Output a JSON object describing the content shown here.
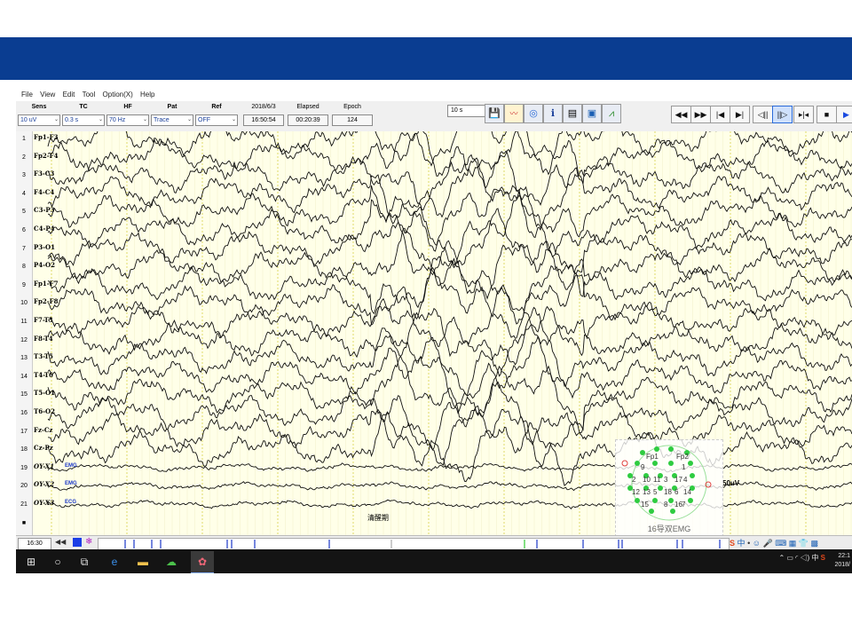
{
  "menu": [
    "File",
    "View",
    "Edit",
    "Tool",
    "Option(X)",
    "Help"
  ],
  "controls": {
    "sens": {
      "label": "Sens",
      "value": "10 uV"
    },
    "tc": {
      "label": "TC",
      "value": "0.3 s"
    },
    "hf": {
      "label": "HF",
      "value": "70 Hz"
    },
    "pat": {
      "label": "Pat",
      "value": "Trace"
    },
    "ref": {
      "label": "Ref",
      "value": "OFF"
    },
    "date": {
      "label": "2018/6/3",
      "value": "16:50:54"
    },
    "elapsed": {
      "label": "Elapsed",
      "value": "00:20:39"
    },
    "epoch": {
      "label": "Epoch",
      "value": "124"
    }
  },
  "window_select": "10 s",
  "toolbar_icons": [
    "save-icon",
    "signal-on-icon",
    "globe-icon",
    "patient-icon",
    "printer-icon",
    "camera-icon",
    "chart-icon"
  ],
  "nav_buttons": [
    {
      "glyph": "◀◀",
      "name": "rewind"
    },
    {
      "glyph": "▶▶",
      "name": "fast-forward"
    },
    {
      "glyph": "|◀",
      "name": "page-start"
    },
    {
      "glyph": "▶|",
      "name": "page-end"
    },
    {
      "glyph": "◁||",
      "name": "step-back"
    },
    {
      "glyph": "||▷",
      "name": "step-forward"
    },
    {
      "glyph": "▸|◂",
      "name": "compress"
    },
    {
      "glyph": "■",
      "name": "stop"
    },
    {
      "glyph": "▶",
      "name": "play"
    }
  ],
  "channels": [
    {
      "num": "1",
      "label": "Fp1-F3"
    },
    {
      "num": "2",
      "label": "Fp2-F4"
    },
    {
      "num": "3",
      "label": "F3-C3"
    },
    {
      "num": "4",
      "label": "F4-C4"
    },
    {
      "num": "5",
      "label": "C3-P3"
    },
    {
      "num": "6",
      "label": "C4-P4"
    },
    {
      "num": "7",
      "label": "P3-O1"
    },
    {
      "num": "8",
      "label": "P4-O2"
    },
    {
      "num": "9",
      "label": "Fp1-F7"
    },
    {
      "num": "10",
      "label": "Fp2-F8"
    },
    {
      "num": "11",
      "label": "F7-T3"
    },
    {
      "num": "12",
      "label": "F8-T4"
    },
    {
      "num": "13",
      "label": "T3-T5"
    },
    {
      "num": "14",
      "label": "T4-T6"
    },
    {
      "num": "15",
      "label": "T5-O1"
    },
    {
      "num": "16",
      "label": "T6-O2"
    },
    {
      "num": "17",
      "label": "Fz-Cz"
    },
    {
      "num": "18",
      "label": "Cz-Pz"
    },
    {
      "num": "19",
      "label": "OY-X1",
      "type": "EMG"
    },
    {
      "num": "20",
      "label": "OY-X2",
      "type": "EMG"
    },
    {
      "num": "21",
      "label": "OY-X3",
      "type": "ECG"
    },
    {
      "num": "■",
      "label": ""
    }
  ],
  "scale_label": "50uV",
  "annotation": "清醒期",
  "montage": {
    "title": "16导双EMG",
    "pins": [
      "Fp1",
      "Fp2",
      "9",
      "1",
      "2",
      "10",
      "11",
      "3",
      "17",
      "4",
      "12",
      "13",
      "5",
      "18",
      "6",
      "14",
      "15",
      "7",
      "8",
      "16"
    ]
  },
  "status": {
    "time": "16:30"
  },
  "clock": {
    "time": "22:1",
    "date": "2018/"
  }
}
